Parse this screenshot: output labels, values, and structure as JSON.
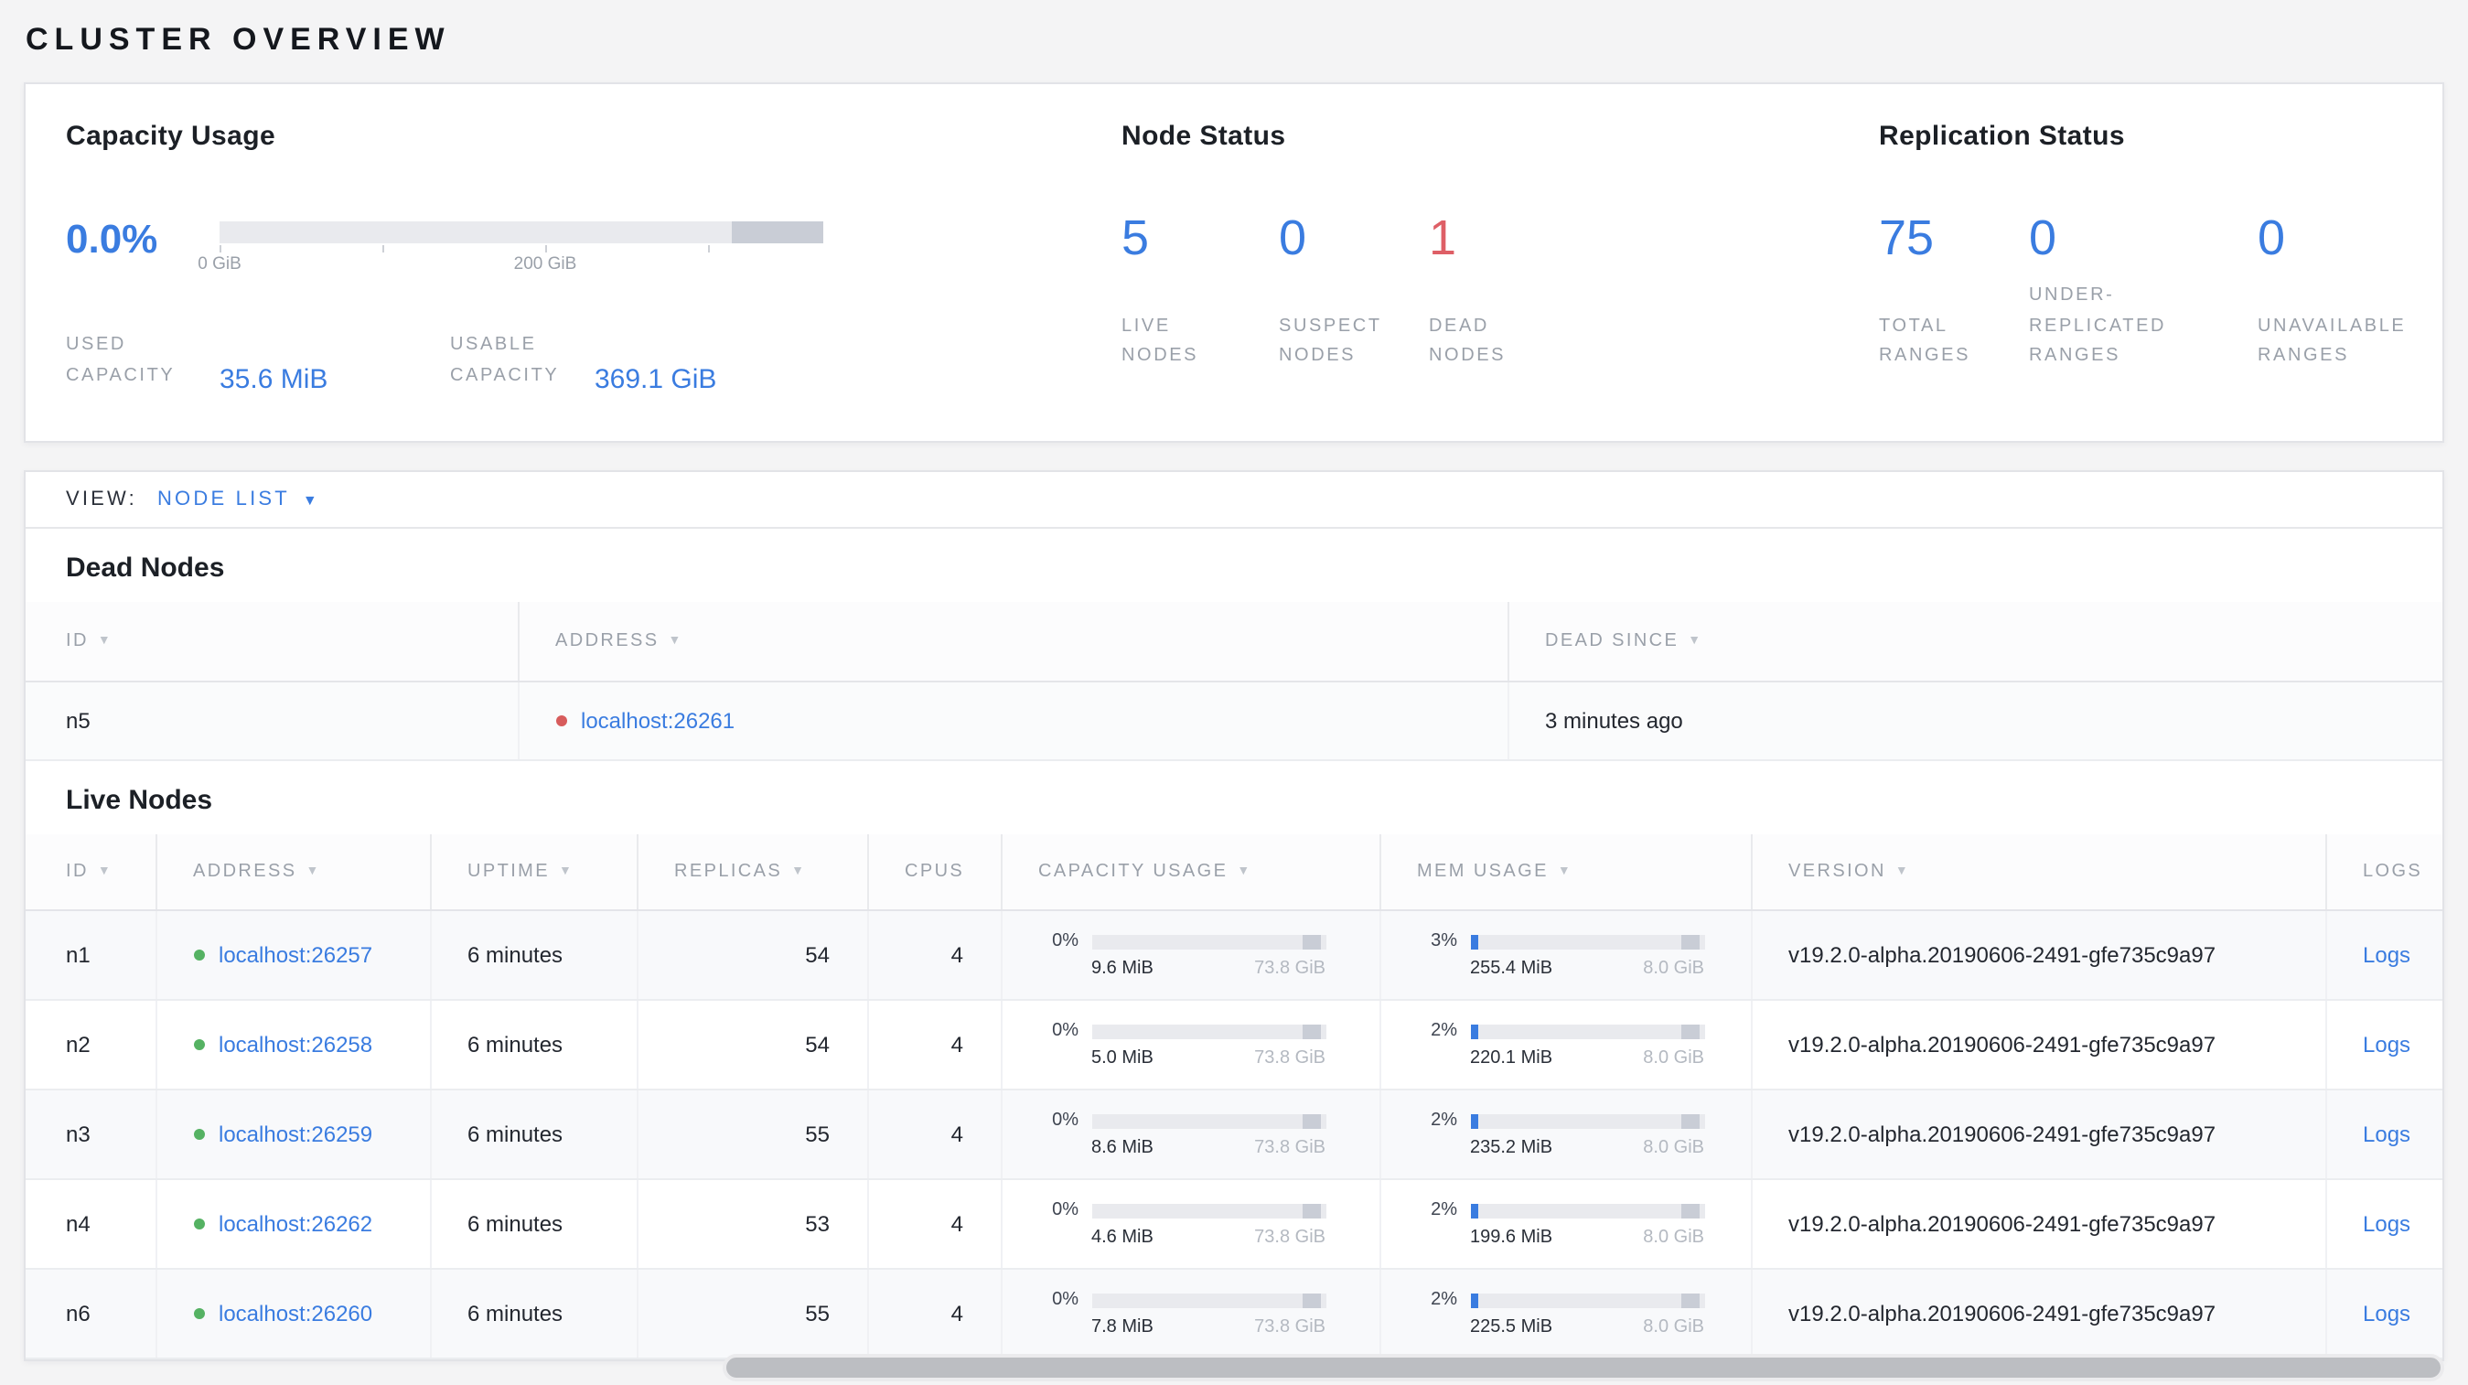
{
  "page_title": "CLUSTER OVERVIEW",
  "summary": {
    "capacity": {
      "title": "Capacity Usage",
      "percent": "0.0%",
      "axis_ticks": [
        "0 GiB",
        "200 GiB"
      ],
      "used_label": "USED\nCAPACITY",
      "used_value": "35.6 MiB",
      "usable_label": "USABLE\nCAPACITY",
      "usable_value": "369.1 GiB"
    },
    "node_status": {
      "title": "Node Status",
      "stats": [
        {
          "value": "5",
          "label": "LIVE\nNODES",
          "color": "blue"
        },
        {
          "value": "0",
          "label": "SUSPECT\nNODES",
          "color": "blue"
        },
        {
          "value": "1",
          "label": "DEAD\nNODES",
          "color": "red"
        }
      ]
    },
    "replication": {
      "title": "Replication Status",
      "stats": [
        {
          "value": "75",
          "label": "TOTAL\nRANGES",
          "color": "blue"
        },
        {
          "value": "0",
          "label": "UNDER-\nREPLICATED\nRANGES",
          "color": "blue"
        },
        {
          "value": "0",
          "label": "UNAVAILABLE\nRANGES",
          "color": "blue"
        }
      ]
    }
  },
  "view_bar": {
    "label": "VIEW:",
    "selected": "NODE LIST"
  },
  "dead_nodes": {
    "title": "Dead Nodes",
    "columns": [
      {
        "label": "ID",
        "sortable": true
      },
      {
        "label": "ADDRESS",
        "sortable": true
      },
      {
        "label": "DEAD SINCE",
        "sortable": true
      }
    ],
    "rows": [
      {
        "id": "n5",
        "address": "localhost:26261",
        "dead_since": "3 minutes ago"
      }
    ]
  },
  "live_nodes": {
    "title": "Live Nodes",
    "columns": [
      {
        "label": "ID",
        "sortable": true
      },
      {
        "label": "ADDRESS",
        "sortable": true
      },
      {
        "label": "UPTIME",
        "sortable": true
      },
      {
        "label": "REPLICAS",
        "sortable": true
      },
      {
        "label": "CPUS",
        "sortable": false
      },
      {
        "label": "CAPACITY USAGE",
        "sortable": true
      },
      {
        "label": "MEM USAGE",
        "sortable": true
      },
      {
        "label": "VERSION",
        "sortable": true
      },
      {
        "label": "LOGS",
        "sortable": false
      }
    ],
    "rows": [
      {
        "id": "n1",
        "address": "localhost:26257",
        "uptime": "6 minutes",
        "replicas": "54",
        "cpus": "4",
        "capacity_pct": "0%",
        "capacity_used": "9.6 MiB",
        "capacity_total": "73.8 GiB",
        "mem_pct": "3%",
        "mem_used": "255.4 MiB",
        "mem_total": "8.0 GiB",
        "version": "v19.2.0-alpha.20190606-2491-gfe735c9a97",
        "logs": "Logs"
      },
      {
        "id": "n2",
        "address": "localhost:26258",
        "uptime": "6 minutes",
        "replicas": "54",
        "cpus": "4",
        "capacity_pct": "0%",
        "capacity_used": "5.0 MiB",
        "capacity_total": "73.8 GiB",
        "mem_pct": "2%",
        "mem_used": "220.1 MiB",
        "mem_total": "8.0 GiB",
        "version": "v19.2.0-alpha.20190606-2491-gfe735c9a97",
        "logs": "Logs"
      },
      {
        "id": "n3",
        "address": "localhost:26259",
        "uptime": "6 minutes",
        "replicas": "55",
        "cpus": "4",
        "capacity_pct": "0%",
        "capacity_used": "8.6 MiB",
        "capacity_total": "73.8 GiB",
        "mem_pct": "2%",
        "mem_used": "235.2 MiB",
        "mem_total": "8.0 GiB",
        "version": "v19.2.0-alpha.20190606-2491-gfe735c9a97",
        "logs": "Logs"
      },
      {
        "id": "n4",
        "address": "localhost:26262",
        "uptime": "6 minutes",
        "replicas": "53",
        "cpus": "4",
        "capacity_pct": "0%",
        "capacity_used": "4.6 MiB",
        "capacity_total": "73.8 GiB",
        "mem_pct": "2%",
        "mem_used": "199.6 MiB",
        "mem_total": "8.0 GiB",
        "version": "v19.2.0-alpha.20190606-2491-gfe735c9a97",
        "logs": "Logs"
      },
      {
        "id": "n6",
        "address": "localhost:26260",
        "uptime": "6 minutes",
        "replicas": "55",
        "cpus": "4",
        "capacity_pct": "0%",
        "capacity_used": "7.8 MiB",
        "capacity_total": "73.8 GiB",
        "mem_pct": "2%",
        "mem_used": "225.5 MiB",
        "mem_total": "8.0 GiB",
        "version": "v19.2.0-alpha.20190606-2491-gfe735c9a97",
        "logs": "Logs"
      }
    ]
  },
  "colors": {
    "accent_blue": "#3a7ce0",
    "dead_red": "#de5f66",
    "live_green": "#55b263"
  }
}
